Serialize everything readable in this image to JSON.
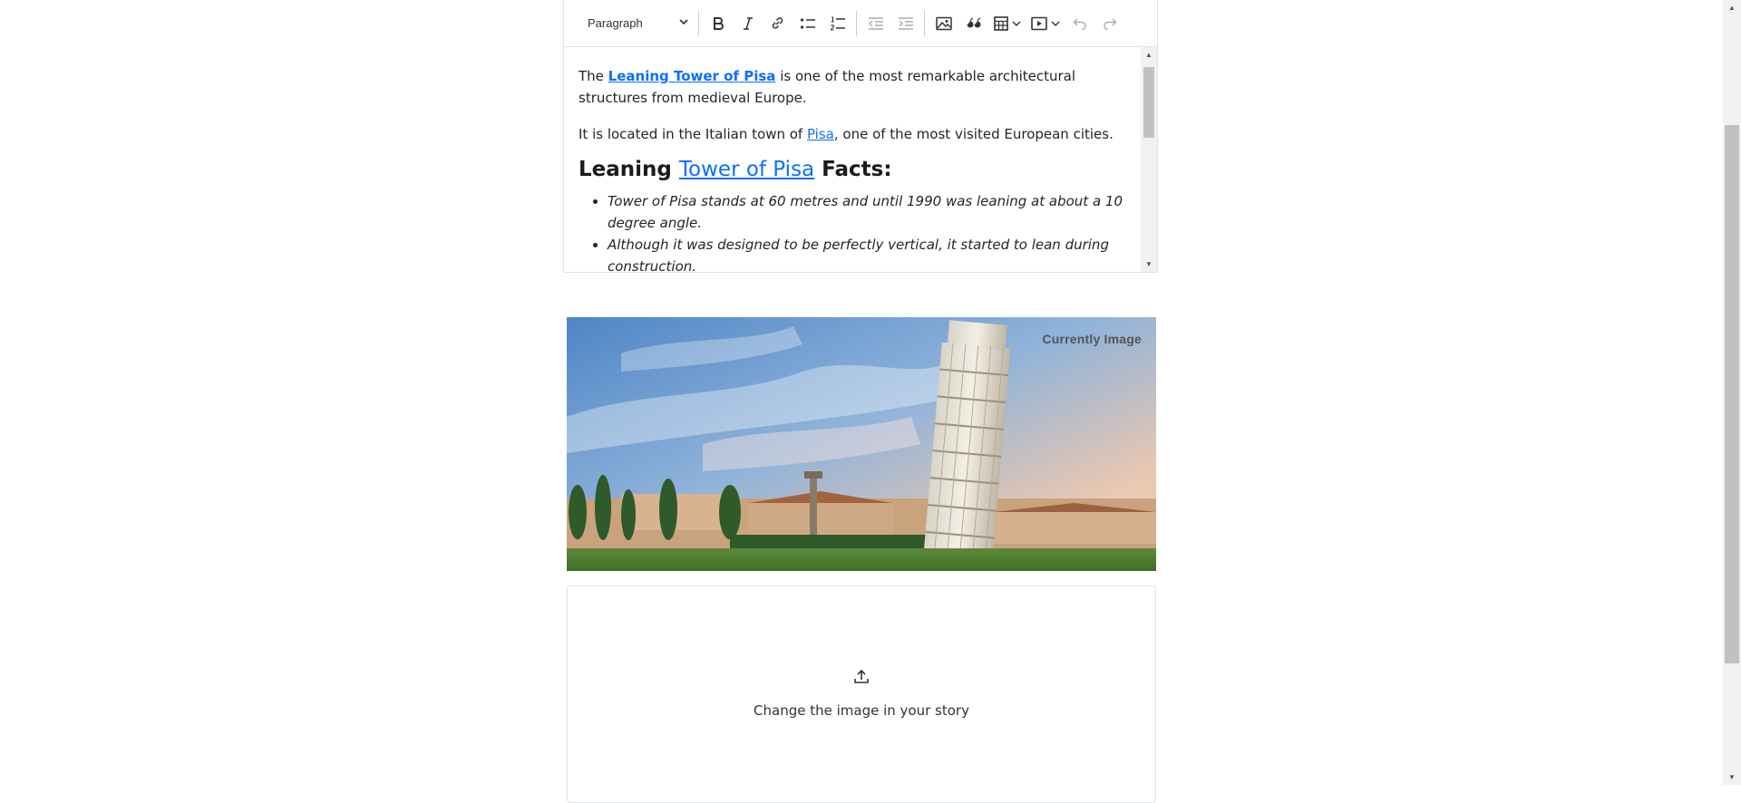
{
  "toolbar": {
    "format_select": "Paragraph",
    "buttons": [
      "bold-icon",
      "italic-icon",
      "link-icon",
      "bulleted-list-icon",
      "numbered-list-icon",
      "outdent-icon",
      "indent-icon",
      "image-icon",
      "quote-icon",
      "table-icon",
      "media-icon",
      "undo-icon",
      "redo-icon"
    ]
  },
  "content": {
    "p1_pre": "The ",
    "p1_link": " Leaning Tower of Pisa",
    "p1_post": " is one of the most remarkable architectural structures from medieval Europe.",
    "p2_pre": "It is located in the Italian town of ",
    "p2_link": "Pisa",
    "p2_post": ", one of the most visited European cities.",
    "h2_pre": "Leaning ",
    "h2_link": " Tower of Pisa",
    "h2_post": " Facts:",
    "bullets": [
      "Tower of Pisa stands at 60 metres and until 1990 was leaning at about a 10 degree angle.",
      "Although it was designed to be perfectly vertical, it started to lean during construction."
    ]
  },
  "image_card": {
    "label": "Currently Image"
  },
  "upload": {
    "text": "Change the image in your story",
    "icon": "upload-icon"
  },
  "colors": {
    "link": "#0d6efd",
    "border": "#dee2e6"
  }
}
